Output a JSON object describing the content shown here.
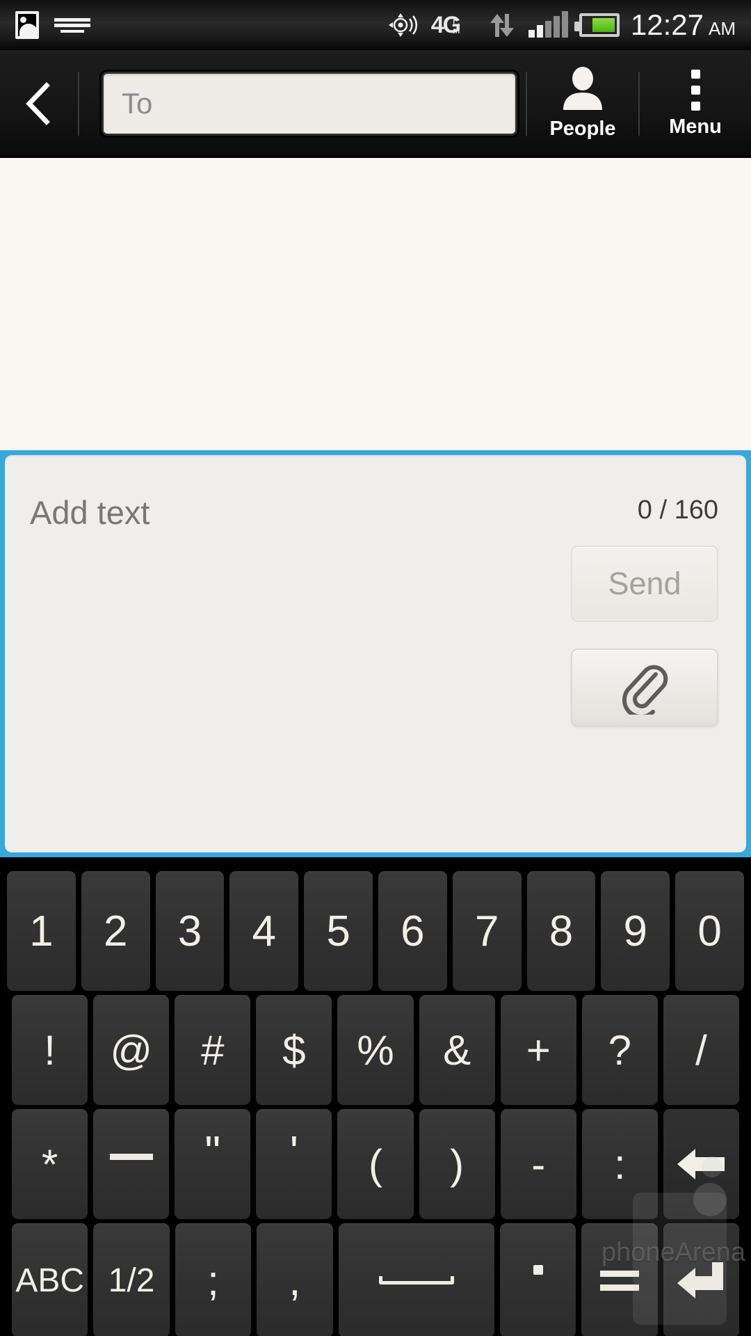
{
  "statusbar": {
    "icons_left": [
      "photo-icon",
      "keyboard-icon"
    ],
    "icons_right": [
      "gps-icon",
      "4g-lte-icon",
      "data-transfer-icon",
      "signal-bars-icon",
      "battery-icon"
    ],
    "network_label": "4G",
    "network_sub": "LTE",
    "time": "12:27",
    "ampm": "AM"
  },
  "actionbar": {
    "back_icon": "back-chevron-icon",
    "to_field": {
      "value": "",
      "placeholder": "To"
    },
    "people": {
      "label": "People",
      "icon": "person-icon"
    },
    "menu": {
      "label": "Menu",
      "icon": "overflow-dots-icon"
    }
  },
  "compose": {
    "placeholder": "Add text",
    "value": "",
    "counter": "0 / 160",
    "send_label": "Send",
    "attach_icon": "paperclip-icon",
    "accent_color": "#36a8dc",
    "field_bg": "#f0eeea"
  },
  "keyboard": {
    "rows": [
      {
        "keys": [
          {
            "label": "1",
            "name": "key-1"
          },
          {
            "label": "2",
            "name": "key-2"
          },
          {
            "label": "3",
            "name": "key-3"
          },
          {
            "label": "4",
            "name": "key-4"
          },
          {
            "label": "5",
            "name": "key-5"
          },
          {
            "label": "6",
            "name": "key-6"
          },
          {
            "label": "7",
            "name": "key-7"
          },
          {
            "label": "8",
            "name": "key-8"
          },
          {
            "label": "9",
            "name": "key-9"
          },
          {
            "label": "0",
            "name": "key-0"
          }
        ]
      },
      {
        "keys": [
          {
            "label": "!",
            "name": "key-exclamation"
          },
          {
            "label": "@",
            "name": "key-at"
          },
          {
            "label": "#",
            "name": "key-hash"
          },
          {
            "label": "$",
            "name": "key-dollar"
          },
          {
            "label": "%",
            "name": "key-percent"
          },
          {
            "label": "&",
            "name": "key-ampersand"
          },
          {
            "label": "+",
            "name": "key-plus"
          },
          {
            "label": "?",
            "name": "key-question"
          },
          {
            "label": "/",
            "name": "key-slash"
          }
        ]
      },
      {
        "keys": [
          {
            "label": "*",
            "name": "key-asterisk"
          },
          {
            "label": "_",
            "name": "key-underscore"
          },
          {
            "label": "\"",
            "name": "key-doublequote"
          },
          {
            "label": "'",
            "name": "key-apostrophe"
          },
          {
            "label": "(",
            "name": "key-open-paren"
          },
          {
            "label": ")",
            "name": "key-close-paren"
          },
          {
            "label": "-",
            "name": "key-hyphen"
          },
          {
            "label": ":",
            "name": "key-colon"
          },
          {
            "label": "",
            "name": "key-backspace"
          }
        ]
      },
      {
        "keys": [
          {
            "label": "ABC",
            "name": "key-abc"
          },
          {
            "label": "1/2",
            "name": "key-page-toggle"
          },
          {
            "label": ";",
            "name": "key-semicolon"
          },
          {
            "label": ",",
            "name": "key-comma"
          },
          {
            "label": "",
            "name": "key-space"
          },
          {
            "label": ".",
            "name": "key-period"
          },
          {
            "label": "=",
            "name": "key-equals"
          },
          {
            "label": "",
            "name": "key-enter"
          }
        ]
      }
    ],
    "backspace_icon": "backspace-arrow-icon",
    "enter_icon": "enter-return-icon",
    "space_icon": "spacebar-icon"
  },
  "watermark": {
    "text": "phoneArena"
  }
}
